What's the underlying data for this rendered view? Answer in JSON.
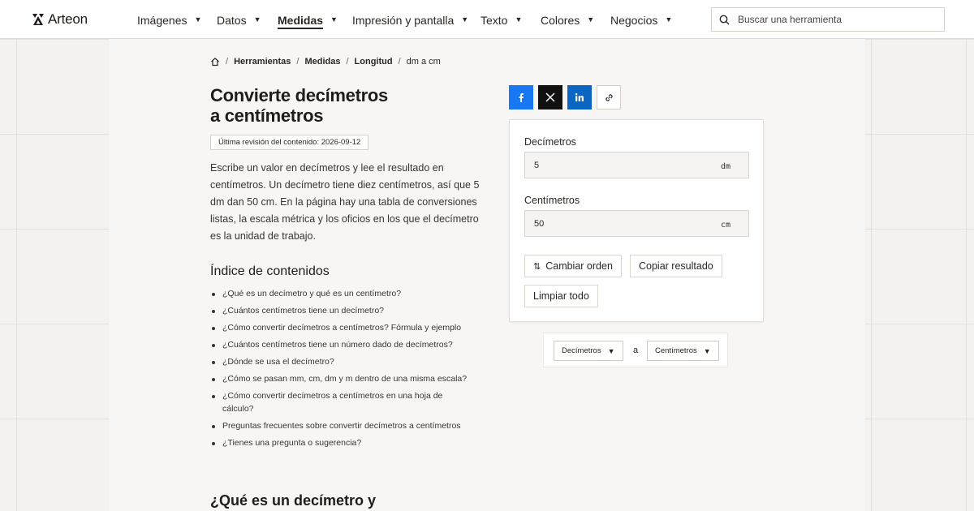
{
  "header": {
    "logo_text": "Arteon",
    "nav": [
      {
        "label": "Imágenes"
      },
      {
        "label": "Datos"
      },
      {
        "label": "Medidas"
      },
      {
        "label": "Impresión y pantalla"
      },
      {
        "label": "Texto"
      },
      {
        "label": "Colores"
      },
      {
        "label": "Negocios"
      }
    ],
    "active_nav": "Medidas",
    "search_placeholder": "Buscar una herramienta"
  },
  "breadcrumb": {
    "items": [
      "Herramientas",
      "Medidas",
      "Longitud"
    ],
    "current": "dm a cm"
  },
  "page": {
    "title_line1": "Convierte decímetros",
    "title_line2": "a centímetros",
    "revision": "Última revisión del contenido: 2026-09-12",
    "intro": "Escribe un valor en decímetros y lee el resultado en centímetros. Un decímetro tiene diez centímetros, así que 5 dm dan 50 cm. En la página hay una tabla de conversiones listas, la escala métrica y los oficios en los que el decímetro es la unidad de trabajo.",
    "toc_title": "Índice de contenidos",
    "toc": [
      "¿Qué es un decímetro y qué es un centímetro?",
      "¿Cuántos centímetros tiene un decímetro?",
      "¿Cómo convertir decímetros a centímetros? Fórmula y ejemplo",
      "¿Cuántos centímetros tiene un número dado de decímetros?",
      "¿Dónde se usa el decímetro?",
      "¿Cómo se pasan mm, cm, dm y m dentro de una misma escala?",
      "¿Cómo convertir decímetros a centímetros en una hoja de cálculo?",
      "Preguntas frecuentes sobre convertir decímetros a centímetros",
      "¿Tienes una pregunta o sugerencia?"
    ],
    "section_heading": "¿Qué es un decímetro y"
  },
  "share": {
    "icons": [
      "facebook-icon",
      "x-icon",
      "linkedin-icon",
      "link-icon"
    ],
    "colors": {
      "facebook": "#1877f2",
      "x": "#111111",
      "linkedin": "#0a66c2"
    }
  },
  "converter": {
    "from_label": "Decímetros",
    "from_value": "5",
    "from_unit": "dm",
    "to_label": "Centímetros",
    "to_value": "50",
    "to_unit": "cm",
    "swap_label": "Cambiar orden",
    "copy_label": "Copiar resultado",
    "clear_label": "Limpiar todo"
  },
  "unit_selector": {
    "from": "Decímetros",
    "connector": "a",
    "to": "Centímetros"
  }
}
